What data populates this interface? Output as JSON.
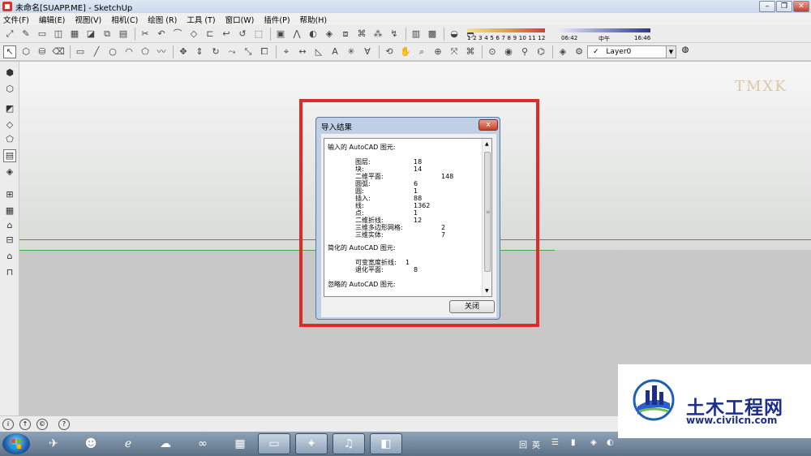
{
  "window": {
    "title": "未命名[SUAPP.ME] - SketchUp"
  },
  "menu": [
    "文件(F)",
    "编辑(E)",
    "视图(V)",
    "相机(C)",
    "绘图 (R)",
    "工具 (T)",
    "窗口(W)",
    "插件(P)",
    "帮助(H)"
  ],
  "shadow": {
    "months": "1  2  3  4  5  6  7  8  9  10 11 12",
    "time_start": "06:42",
    "time_mid": "中午",
    "time_end": "16:46"
  },
  "layer": {
    "current": "Layer0",
    "check": "✓"
  },
  "watermark": "TMXK",
  "dialog": {
    "title": "导入结果",
    "close_glyph": "x",
    "section_input": "输入的 AutoCAD 图元:",
    "input_items": [
      {
        "label": "图层:",
        "value": "18"
      },
      {
        "label": "块:",
        "value": "14"
      },
      {
        "label": "二维平面:",
        "value": "148"
      },
      {
        "label": "圆弧:",
        "value": "6"
      },
      {
        "label": "圆:",
        "value": "1"
      },
      {
        "label": "插入:",
        "value": "88"
      },
      {
        "label": "线:",
        "value": "1362"
      },
      {
        "label": "点:",
        "value": "1"
      },
      {
        "label": "二维折线:",
        "value": "12"
      },
      {
        "label": "三维多边形网格:",
        "value": "2"
      },
      {
        "label": "三维实体:",
        "value": "7"
      }
    ],
    "section_simplified": "简化的 AutoCAD 图元:",
    "simplified_items": [
      {
        "label": "可变宽度折线:",
        "value": "1"
      },
      {
        "label": "退化平面:",
        "value": "8"
      }
    ],
    "section_ignored": "忽略的 AutoCAD 图元:",
    "close_button": "关闭"
  },
  "status_icons": [
    "i",
    "↑",
    "©",
    "?"
  ],
  "taskbar": {
    "tray_lang": "英",
    "tray_other": "回"
  },
  "logo": {
    "name": "土木工程网",
    "url": "www.civilcn.com"
  },
  "colors": {
    "highlight_box": "#e02a2a",
    "red_axis": "#b55a5a",
    "green_axis": "#4aa44a",
    "logo_blue": "#1d2f8a"
  }
}
